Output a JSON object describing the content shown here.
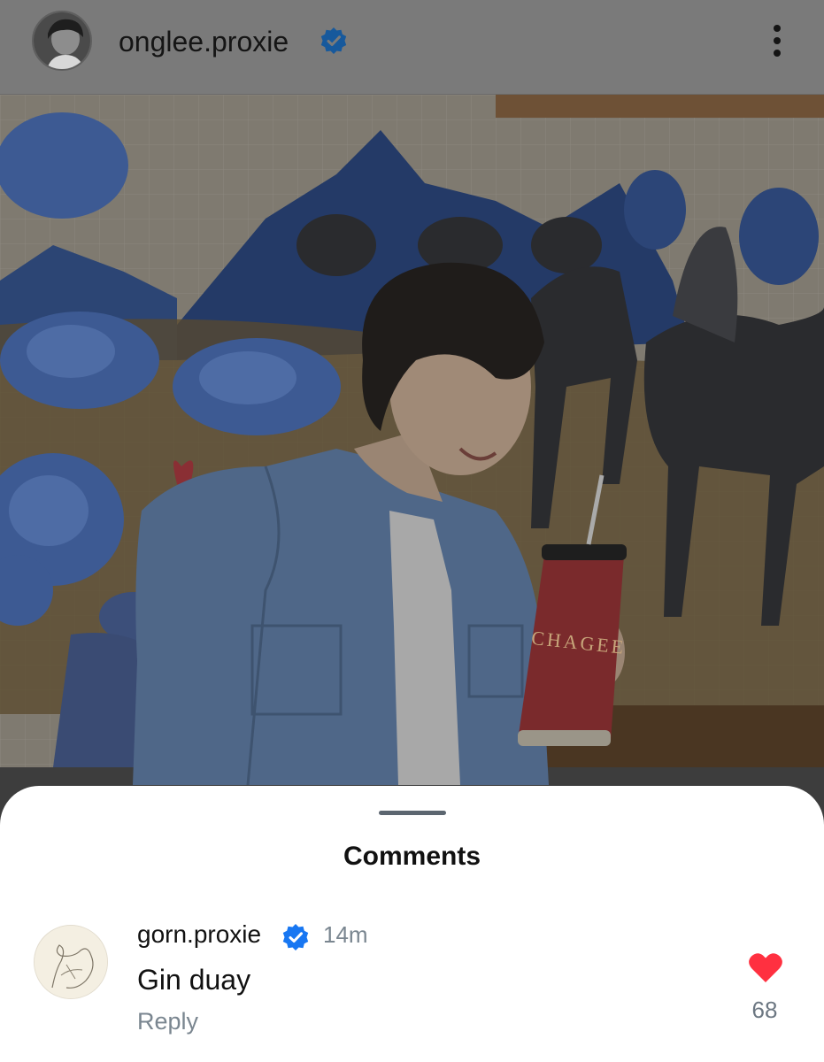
{
  "header": {
    "username": "onglee.proxie",
    "verified_icon": "verified-badge-icon",
    "more_icon": "more-vertical-icon"
  },
  "photo": {
    "cup_text": "CHAGEE"
  },
  "comments_sheet": {
    "title": "Comments",
    "comments": [
      {
        "username": "gorn.proxie",
        "time": "14m",
        "text": "Gin duay",
        "reply_label": "Reply",
        "likes": "68",
        "liked": true
      }
    ]
  },
  "colors": {
    "verified_blue": "#1877f2",
    "heart_red": "#ff3040",
    "overlay": "#7a7a7a"
  }
}
